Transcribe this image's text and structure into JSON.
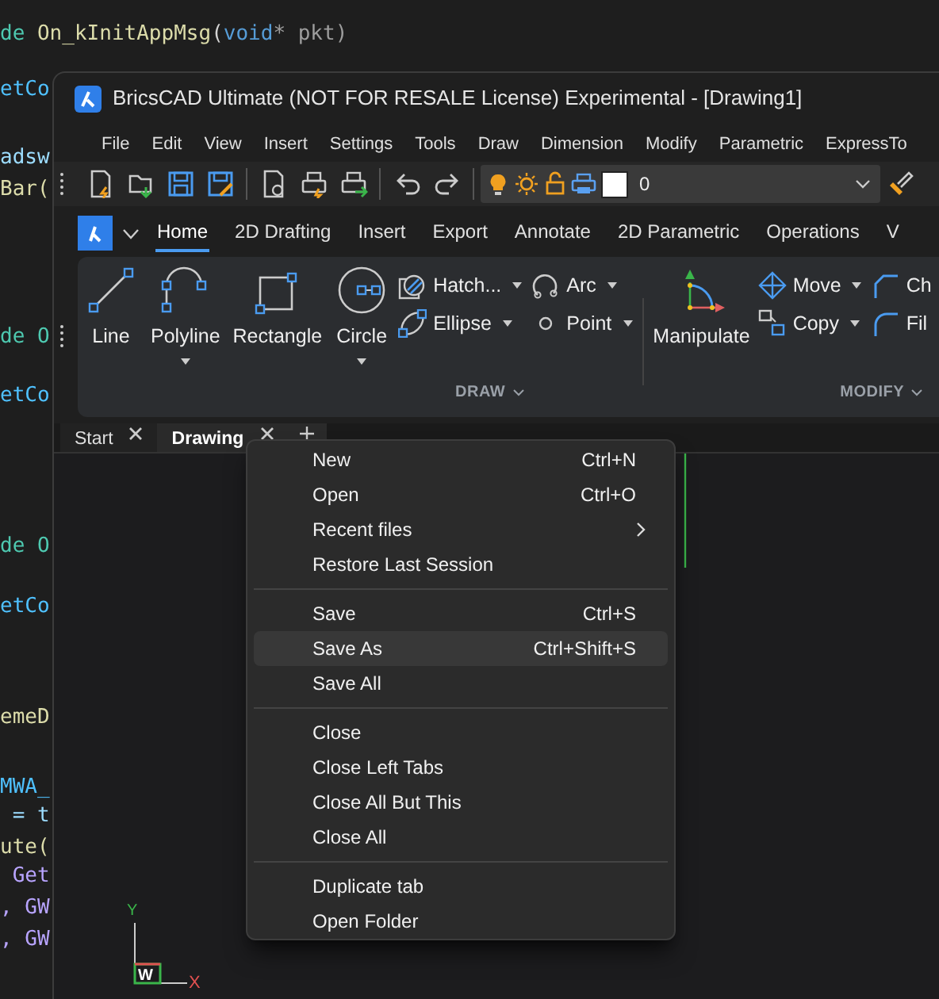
{
  "code_lines": [
    {
      "segments": [
        {
          "text": "de ",
          "color": "#4ec9b0"
        },
        {
          "text": "On_kInitAppMsg",
          "color": "#dcdcaa"
        },
        {
          "text": "(",
          "color": "#d4d4d4"
        },
        {
          "text": "void",
          "color": "#569cd6"
        },
        {
          "text": "* pkt)",
          "color": "#9d9d9d"
        }
      ]
    },
    {
      "segments": [
        {
          "text": "etCo",
          "color": "#4fc1ff"
        }
      ]
    },
    {
      "segments": [
        {
          "text": "adsw",
          "color": "#9cdcfe"
        }
      ]
    },
    {
      "segments": [
        {
          "text": "Bar(",
          "color": "#dcdcaa"
        }
      ]
    },
    {
      "segments": [
        {
          "text": "de O",
          "color": "#4ec9b0"
        }
      ]
    },
    {
      "segments": [
        {
          "text": "etCo",
          "color": "#4fc1ff"
        }
      ]
    },
    {
      "segments": [
        {
          "text": "de O",
          "color": "#4ec9b0"
        }
      ]
    },
    {
      "segments": [
        {
          "text": "etCo",
          "color": "#4fc1ff"
        }
      ]
    },
    {
      "segments": [
        {
          "text": "emeD",
          "color": "#dcdcaa"
        }
      ]
    },
    {
      "segments": [
        {
          "text": "MWA_",
          "color": "#4fc1ff"
        }
      ]
    },
    {
      "segments": [
        {
          "text": " = t",
          "color": "#9cdcfe"
        }
      ]
    },
    {
      "segments": [
        {
          "text": "ute(",
          "color": "#dcdcaa"
        }
      ]
    },
    {
      "segments": [
        {
          "text": " Get",
          "color": "#b8a4ff"
        }
      ]
    },
    {
      "segments": [
        {
          "text": ", GW",
          "color": "#b8a4ff"
        }
      ]
    },
    {
      "segments": [
        {
          "text": ", GW",
          "color": "#b8a4ff"
        }
      ]
    }
  ],
  "window": {
    "title": "BricsCAD Ultimate (NOT FOR RESALE License) Experimental - [Drawing1]"
  },
  "menu_bar": [
    "File",
    "Edit",
    "View",
    "Insert",
    "Settings",
    "Tools",
    "Draw",
    "Dimension",
    "Modify",
    "Parametric",
    "ExpressTo"
  ],
  "layer_combo": {
    "value": "0"
  },
  "ribbon_tabs": [
    {
      "label": "Home",
      "selected": true
    },
    {
      "label": "2D Drafting",
      "selected": false
    },
    {
      "label": "Insert",
      "selected": false
    },
    {
      "label": "Export",
      "selected": false
    },
    {
      "label": "Annotate",
      "selected": false
    },
    {
      "label": "2D Parametric",
      "selected": false
    },
    {
      "label": "Operations",
      "selected": false
    },
    {
      "label": "V",
      "selected": false
    }
  ],
  "draw_panel": {
    "title": "DRAW",
    "large_buttons": [
      {
        "label": "Line",
        "dropdown": false
      },
      {
        "label": "Polyline",
        "dropdown": true
      },
      {
        "label": "Rectangle",
        "dropdown": false
      },
      {
        "label": "Circle",
        "dropdown": true
      }
    ],
    "small_buttons": [
      {
        "label": "Hatch..."
      },
      {
        "label": "Ellipse"
      },
      {
        "label": "Arc"
      },
      {
        "label": "Point"
      }
    ]
  },
  "modify_panel": {
    "title": "MODIFY",
    "large_button": "Manipulate",
    "small_buttons": [
      {
        "label": "Move"
      },
      {
        "label": "Copy"
      },
      {
        "label": "Ch"
      },
      {
        "label": "Fil"
      }
    ]
  },
  "document_tabs": [
    {
      "label": "Start",
      "selected": false
    },
    {
      "label": "Drawing",
      "selected": true
    }
  ],
  "context_menu": {
    "groups": [
      [
        {
          "label": "New",
          "shortcut": "Ctrl+N",
          "selected": false
        },
        {
          "label": "Open",
          "shortcut": "Ctrl+O",
          "selected": false
        },
        {
          "label": "Recent files",
          "submenu": true,
          "selected": false
        },
        {
          "label": "Restore Last Session",
          "selected": false
        }
      ],
      [
        {
          "label": "Save",
          "shortcut": "Ctrl+S",
          "selected": false
        },
        {
          "label": "Save As",
          "shortcut": "Ctrl+Shift+S",
          "selected": true
        },
        {
          "label": "Save All",
          "selected": false
        }
      ],
      [
        {
          "label": "Close",
          "selected": false
        },
        {
          "label": "Close Left Tabs",
          "selected": false
        },
        {
          "label": "Close All But This",
          "selected": false
        },
        {
          "label": "Close All",
          "selected": false
        }
      ],
      [
        {
          "label": "Duplicate tab",
          "selected": false
        },
        {
          "label": "Open Folder",
          "selected": false
        }
      ]
    ]
  },
  "ucs_icon": {
    "x_label": "X",
    "y_label": "Y",
    "origin_label": "W"
  }
}
